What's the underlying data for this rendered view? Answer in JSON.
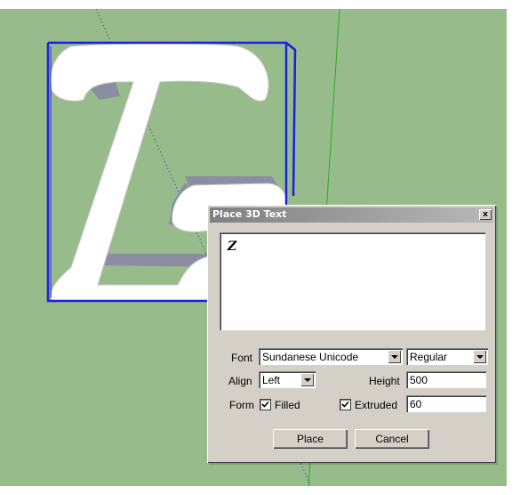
{
  "dialog": {
    "title": "Place 3D Text",
    "close_label": "x",
    "text_value": "Z",
    "font": {
      "label": "Font",
      "value": "Sundanese Unicode"
    },
    "style": {
      "value": "Regular"
    },
    "align": {
      "label": "Align",
      "value": "Left"
    },
    "height": {
      "label": "Height",
      "value": "500"
    },
    "form": {
      "label": "Form",
      "filled": {
        "label": "Filled",
        "checked": true
      },
      "extruded": {
        "label": "Extruded",
        "checked": true,
        "value": "60"
      }
    },
    "buttons": {
      "place": "Place",
      "cancel": "Cancel"
    }
  },
  "colors": {
    "ground": "#98bb8c",
    "selection": "#1b1fe0",
    "green_axis": "#22b022",
    "side_face": "#8a8ea0"
  }
}
